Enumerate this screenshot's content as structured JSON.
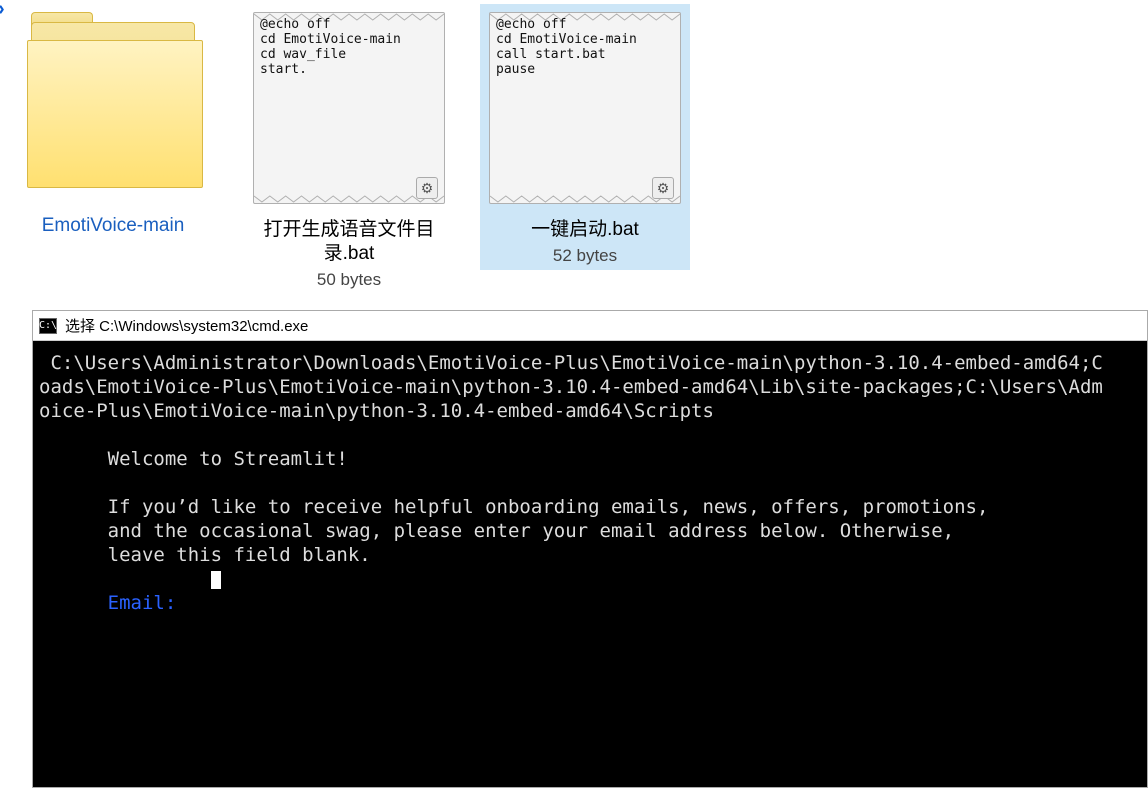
{
  "explorer": {
    "shared_indicator": "›",
    "items": [
      {
        "type": "folder",
        "name": "EmotiVoice-main"
      },
      {
        "type": "bat",
        "name": "打开生成语音文件目录.bat",
        "size": "50 bytes",
        "preview": "@echo off\ncd EmotiVoice-main\ncd wav_file\nstart."
      },
      {
        "type": "bat",
        "name": "一键启动.bat",
        "size": "52 bytes",
        "selected": true,
        "preview": "@echo off\ncd EmotiVoice-main\ncall start.bat\npause"
      }
    ]
  },
  "terminal": {
    "icon_text": "C:\\",
    "title": "选择 C:\\Windows\\system32\\cmd.exe",
    "path_lines": " C:\\Users\\Administrator\\Downloads\\EmotiVoice-Plus\\EmotiVoice-main\\python-3.10.4-embed-amd64;C\noads\\EmotiVoice-Plus\\EmotiVoice-main\\python-3.10.4-embed-amd64\\Lib\\site-packages;C:\\Users\\Adm\noice-Plus\\EmotiVoice-main\\python-3.10.4-embed-amd64\\Scripts",
    "welcome": "      Welcome to Streamlit!",
    "body": "      If you’d like to receive helpful onboarding emails, news, offers, promotions,\n      and the occasional swag, please enter your email address below. Otherwise,\n      leave this field blank.",
    "email_label": "      Email:"
  }
}
